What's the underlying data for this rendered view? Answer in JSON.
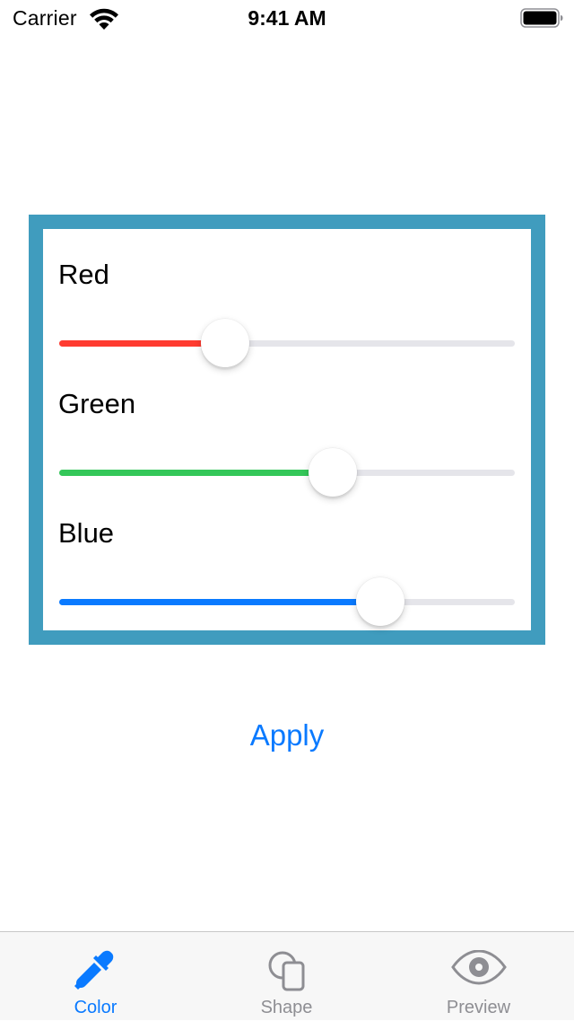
{
  "status_bar": {
    "carrier": "Carrier",
    "time": "9:41 AM"
  },
  "panel": {
    "border_color": "#409cbe",
    "sliders": [
      {
        "label": "Red",
        "value": 0.365,
        "color": "#ff3b30"
      },
      {
        "label": "Green",
        "value": 0.6,
        "color": "#34c759"
      },
      {
        "label": "Blue",
        "value": 0.705,
        "color": "#0a7aff"
      }
    ]
  },
  "apply_label": "Apply",
  "tab_bar": {
    "active_color": "#0a7aff",
    "inactive_color": "#8e8e93",
    "tabs": [
      {
        "label": "Color",
        "icon": "eyedropper-icon",
        "active": true
      },
      {
        "label": "Shape",
        "icon": "shapes-icon",
        "active": false
      },
      {
        "label": "Preview",
        "icon": "eye-icon",
        "active": false
      }
    ]
  }
}
